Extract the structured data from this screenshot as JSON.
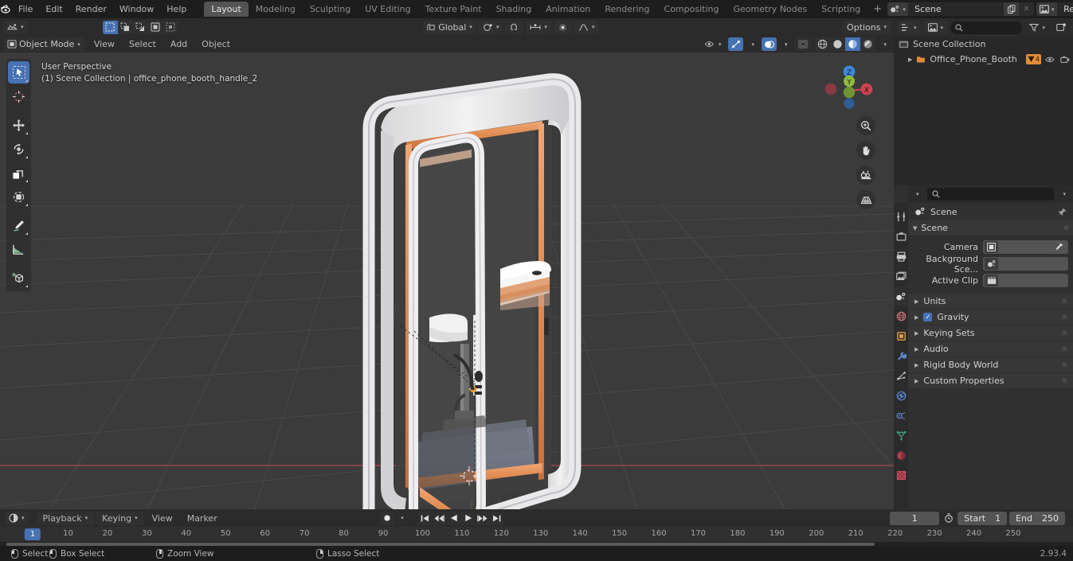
{
  "app": {
    "name": "Blender",
    "version": "2.93.4"
  },
  "topbar": {
    "menus": [
      "File",
      "Edit",
      "Render",
      "Window",
      "Help"
    ],
    "workspaces": [
      {
        "label": "Layout",
        "active": true
      },
      {
        "label": "Modeling",
        "active": false
      },
      {
        "label": "Sculpting",
        "active": false
      },
      {
        "label": "UV Editing",
        "active": false
      },
      {
        "label": "Texture Paint",
        "active": false
      },
      {
        "label": "Shading",
        "active": false
      },
      {
        "label": "Animation",
        "active": false
      },
      {
        "label": "Rendering",
        "active": false
      },
      {
        "label": "Compositing",
        "active": false
      },
      {
        "label": "Geometry Nodes",
        "active": false
      },
      {
        "label": "Scripting",
        "active": false
      }
    ],
    "add_workspace": "+",
    "scene_name": "Scene",
    "viewlayer_name": "RenderLayer"
  },
  "viewport_header": {
    "editor_type": "editor-type-3dview",
    "transform_orientation": "Global",
    "options_label": "Options",
    "snap_icon": "magnet-icon",
    "proportional_icon": "proportional-edit-icon"
  },
  "tool_header": {
    "mode": "Object Mode",
    "menus": [
      "View",
      "Select",
      "Add",
      "Object"
    ],
    "select_modes": [
      "select-box",
      "select-extend",
      "select-subtract",
      "select-invert",
      "select-intersect"
    ]
  },
  "viewport": {
    "info_line1": "User Perspective",
    "info_line2": "(1) Scene Collection | office_phone_booth_handle_2",
    "background_color": "#3b3b3b",
    "grid_color": "#555555",
    "x_axis_color": "#c44d55",
    "y_axis_color": "#7fa832",
    "tools": [
      {
        "name": "tweak-select-tool",
        "active": true
      },
      {
        "name": "cursor-tool",
        "active": false
      },
      {
        "name": "move-tool",
        "active": false
      },
      {
        "name": "rotate-tool",
        "active": false
      },
      {
        "name": "scale-tool",
        "active": false
      },
      {
        "name": "transform-tool",
        "active": false
      },
      {
        "name": "annotate-tool",
        "active": false
      },
      {
        "name": "measure-tool",
        "active": false
      },
      {
        "name": "add-cube-tool",
        "active": false
      }
    ],
    "gizmo_axes": [
      {
        "label": "Z",
        "color": "#3f8ad8"
      },
      {
        "label": "Y",
        "color": "#8ebb3f"
      },
      {
        "label": "X",
        "color": "#cc4450"
      }
    ],
    "nav_buttons": [
      "zoom-icon",
      "pan-hand-icon",
      "camera-icon",
      "perspective-grid-icon"
    ],
    "model": {
      "name": "Office Phone Booth",
      "shell_color": "#ebebeb",
      "accent_color": "#e08a50",
      "floor_color": "#6f7582",
      "glass_color": "#424242",
      "seat_color": "#f0f0f0",
      "pole_color": "#6a6a6a"
    }
  },
  "outliner": {
    "search_placeholder": "",
    "rows": [
      {
        "label": "Scene Collection",
        "icon": "collection-icon",
        "depth": 0,
        "badge": null
      },
      {
        "label": "Office_Phone_Booth",
        "icon": "object-data-icon",
        "depth": 1,
        "badge": "4"
      }
    ],
    "row_icons": [
      "eye-icon",
      "camera-icon"
    ]
  },
  "properties": {
    "search_placeholder": "",
    "breadcrumb": "Scene",
    "tabs": [
      {
        "name": "tool-tab",
        "active": false
      },
      {
        "name": "render-tab",
        "active": false
      },
      {
        "name": "output-tab",
        "active": false
      },
      {
        "name": "view-layer-tab",
        "active": false
      },
      {
        "name": "scene-tab",
        "active": true
      },
      {
        "name": "world-tab",
        "active": false
      },
      {
        "name": "object-tab",
        "active": false
      },
      {
        "name": "modifier-tab",
        "active": false
      },
      {
        "name": "particles-tab",
        "active": false
      },
      {
        "name": "physics-tab",
        "active": false
      },
      {
        "name": "constraints-tab",
        "active": false
      },
      {
        "name": "data-tab",
        "active": false
      },
      {
        "name": "material-tab",
        "active": false
      },
      {
        "name": "texture-tab",
        "active": false
      }
    ],
    "scene_panel": {
      "title": "Scene",
      "rows": [
        {
          "label": "Camera",
          "value": "",
          "icon": "camera-data-icon",
          "has_picker": true
        },
        {
          "label": "Background Sce...",
          "value": "",
          "icon": "scene-icon",
          "has_picker": false
        },
        {
          "label": "Active Clip",
          "value": "",
          "icon": "clip-icon",
          "has_picker": false
        }
      ]
    },
    "closed_panels": [
      {
        "label": "Units",
        "checkbox": null
      },
      {
        "label": "Gravity",
        "checkbox": true
      },
      {
        "label": "Keying Sets",
        "checkbox": null
      },
      {
        "label": "Audio",
        "checkbox": null
      },
      {
        "label": "Rigid Body World",
        "checkbox": null
      },
      {
        "label": "Custom Properties",
        "checkbox": null
      }
    ]
  },
  "timeline": {
    "menus": [
      "Playback",
      "Keying",
      "View",
      "Marker"
    ],
    "current_frame": "1",
    "start_label": "Start",
    "start_value": "1",
    "end_label": "End",
    "end_value": "250",
    "ticks": [
      10,
      20,
      30,
      40,
      50,
      60,
      70,
      80,
      90,
      100,
      110,
      120,
      130,
      140,
      150,
      160,
      170,
      180,
      190,
      200,
      210,
      220,
      230,
      240,
      250
    ],
    "playhead_frame": 1,
    "transport": [
      "jump-start-icon",
      "prev-keyframe-icon",
      "play-reverse-icon",
      "play-icon",
      "next-keyframe-icon",
      "jump-end-icon"
    ],
    "record_icon": "record-icon"
  },
  "statusbar": {
    "hints": [
      {
        "mouse": "left",
        "label": "Select"
      },
      {
        "mouse": "left-drag",
        "label": "Box Select"
      },
      {
        "mouse": "middle",
        "label": "Zoom View"
      },
      {
        "mouse": "right",
        "label": "Lasso Select"
      }
    ],
    "version": "2.93.4"
  }
}
